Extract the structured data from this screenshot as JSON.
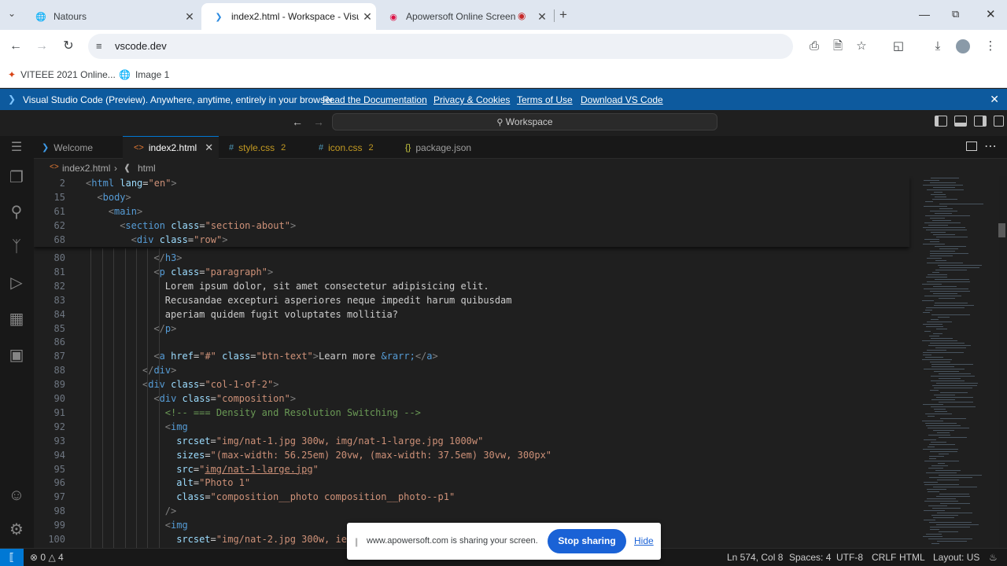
{
  "browser": {
    "tabs": [
      {
        "title": "Natours",
        "icon": "globe-icon"
      },
      {
        "title": "index2.html - Workspace - Visu",
        "icon": "vscode-icon"
      },
      {
        "title": "Apowersoft Online Screen",
        "icon": "apowersoft-icon"
      }
    ],
    "url": "vscode.dev",
    "bookmarks": [
      {
        "label": "VITEEE 2021 Online...",
        "icon": "vit-icon"
      },
      {
        "label": "Image 1",
        "icon": "globe-icon"
      }
    ]
  },
  "banner": {
    "message": "Visual Studio Code (Preview). Anywhere, anytime, entirely in your browser.",
    "links": [
      "Read the Documentation",
      "Privacy & Cookies",
      "Terms of Use",
      "Download VS Code"
    ]
  },
  "vscode": {
    "command_center": "Workspace",
    "tabs": [
      {
        "label": "Welcome",
        "icon": "vscode-icon",
        "count": ""
      },
      {
        "label": "index2.html",
        "icon": "html-icon",
        "count": ""
      },
      {
        "label": "style.css",
        "icon": "css-icon",
        "count": "2"
      },
      {
        "label": "icon.css",
        "icon": "css-icon",
        "count": "2"
      },
      {
        "label": "package.json",
        "icon": "json-icon",
        "count": ""
      }
    ],
    "breadcrumb": [
      "index2.html",
      "html"
    ],
    "sticky_lines": [
      {
        "n": "2",
        "indent": 0,
        "html": "<span class=\"br\">&lt;</span><span class=\"tag\">html</span> <span class=\"at\">lang</span>=<span class=\"st\">\"en\"</span><span class=\"br\">&gt;</span>"
      },
      {
        "n": "15",
        "indent": 1,
        "html": "<span class=\"br\">&lt;</span><span class=\"tag\">body</span><span class=\"br\">&gt;</span>"
      },
      {
        "n": "61",
        "indent": 2,
        "html": "<span class=\"br\">&lt;</span><span class=\"tag\">main</span><span class=\"br\">&gt;</span>"
      },
      {
        "n": "62",
        "indent": 3,
        "html": "<span class=\"br\">&lt;</span><span class=\"tag\">section</span> <span class=\"at\">class</span>=<span class=\"st\">\"section-about\"</span><span class=\"br\">&gt;</span>"
      },
      {
        "n": "68",
        "indent": 4,
        "html": "<span class=\"br\">&lt;</span><span class=\"tag\">div</span> <span class=\"at\">class</span>=<span class=\"st\">\"row\"</span><span class=\"br\">&gt;</span>"
      }
    ],
    "lines": [
      {
        "n": "80",
        "indent": 6,
        "html": "<span class=\"br\">&lt;/</span><span class=\"tag\">h3</span><span class=\"br\">&gt;</span>"
      },
      {
        "n": "81",
        "indent": 6,
        "html": "<span class=\"br\">&lt;</span><span class=\"tag\">p</span> <span class=\"at\">class</span>=<span class=\"st\">\"paragraph\"</span><span class=\"br\">&gt;</span>"
      },
      {
        "n": "82",
        "indent": 7,
        "html": "Lorem ipsum dolor, sit amet consectetur adipisicing elit."
      },
      {
        "n": "83",
        "indent": 7,
        "html": "Recusandae excepturi asperiores neque impedit harum quibusdam"
      },
      {
        "n": "84",
        "indent": 7,
        "html": "aperiam quidem fugit voluptates mollitia?"
      },
      {
        "n": "85",
        "indent": 6,
        "html": "<span class=\"br\">&lt;/</span><span class=\"tag\">p</span><span class=\"br\">&gt;</span>"
      },
      {
        "n": "86",
        "indent": 0,
        "html": ""
      },
      {
        "n": "87",
        "indent": 6,
        "html": "<span class=\"br\">&lt;</span><span class=\"tag\">a</span> <span class=\"at\">href</span>=<span class=\"st\">\"#\"</span> <span class=\"at\">class</span>=<span class=\"st\">\"btn-text\"</span><span class=\"br\">&gt;</span>Learn more <span class=\"en\">&amp;rarr;</span><span class=\"br\">&lt;/</span><span class=\"tag\">a</span><span class=\"br\">&gt;</span>"
      },
      {
        "n": "88",
        "indent": 5,
        "html": "<span class=\"br\">&lt;/</span><span class=\"tag\">div</span><span class=\"br\">&gt;</span>"
      },
      {
        "n": "89",
        "indent": 5,
        "html": "<span class=\"br\">&lt;</span><span class=\"tag\">div</span> <span class=\"at\">class</span>=<span class=\"st\">\"col-1-of-2\"</span><span class=\"br\">&gt;</span>"
      },
      {
        "n": "90",
        "indent": 6,
        "html": "<span class=\"br\">&lt;</span><span class=\"tag\">div</span> <span class=\"at\">class</span>=<span class=\"st\">\"composition\"</span><span class=\"br\">&gt;</span>"
      },
      {
        "n": "91",
        "indent": 7,
        "html": "<span class=\"cm\">&lt;!-- === Density and Resolution Switching --&gt;</span>"
      },
      {
        "n": "92",
        "indent": 7,
        "html": "<span class=\"br\">&lt;</span><span class=\"tag\">img</span>"
      },
      {
        "n": "93",
        "indent": 8,
        "html": "<span class=\"at\">srcset</span>=<span class=\"st\">\"img/nat-1.jpg 300w, img/nat-1-large.jpg 1000w\"</span>"
      },
      {
        "n": "94",
        "indent": 8,
        "html": "<span class=\"at\">sizes</span>=<span class=\"st\">\"(max-width: 56.25em) 20vw, (max-width: 37.5em) 30vw, 300px\"</span>"
      },
      {
        "n": "95",
        "indent": 8,
        "html": "<span class=\"at\">src</span>=<span class=\"st\">\"<span class=\"ul\">img/nat-1-large.jpg</span>\"</span>"
      },
      {
        "n": "96",
        "indent": 8,
        "html": "<span class=\"at\">alt</span>=<span class=\"st\">\"Photo 1\"</span>"
      },
      {
        "n": "97",
        "indent": 8,
        "html": "<span class=\"at\">class</span>=<span class=\"st\">\"composition__photo composition__photo--p1\"</span>"
      },
      {
        "n": "98",
        "indent": 7,
        "html": "<span class=\"br\">/&gt;</span>"
      },
      {
        "n": "99",
        "indent": 7,
        "html": "<span class=\"br\">&lt;</span><span class=\"tag\">img</span>"
      },
      {
        "n": "100",
        "indent": 8,
        "html": "<span class=\"at\">srcset</span>=<span class=\"st\">\"img/nat-2.jpg 300w, ie</span>"
      }
    ]
  },
  "status": {
    "errors": "0",
    "warnings": "4",
    "position": "Ln 574, Col 8",
    "spaces": "Spaces: 4",
    "encoding": "UTF-8",
    "eol": "CRLF",
    "language": "HTML",
    "layout": "Layout: US"
  },
  "share": {
    "message": "www.apowersoft.com is sharing your screen.",
    "stop_label": "Stop sharing",
    "hide_label": "Hide"
  }
}
